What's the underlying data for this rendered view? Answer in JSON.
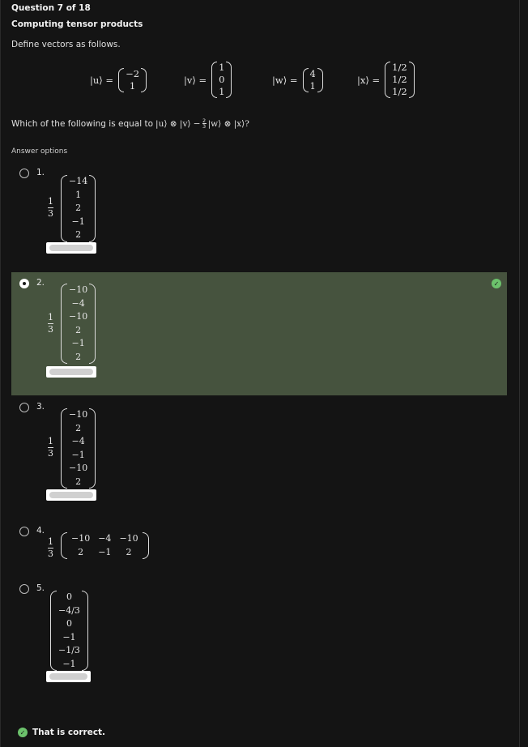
{
  "header": {
    "question_counter": "Question 7 of 18",
    "title": "Computing tensor products"
  },
  "prompt": {
    "intro": "Define vectors as follows.",
    "vectors": [
      {
        "name": "|u⟩ =",
        "entries": [
          "−2",
          "1"
        ]
      },
      {
        "name": "|v⟩ =",
        "entries": [
          "1",
          "0",
          "1"
        ]
      },
      {
        "name": "|w⟩ =",
        "entries": [
          "4",
          "1"
        ]
      },
      {
        "name": "|x⟩ =",
        "entries": [
          "1/2",
          "1/2",
          "1/2"
        ]
      }
    ],
    "question_prefix": "Which of the following is equal to ",
    "question_math_1": "|u⟩ ⊗ |v⟩ − ",
    "question_frac_num": "2",
    "question_frac_den": "3",
    "question_math_2": "|w⟩ ⊗ |x⟩?",
    "answer_options_label": "Answer options"
  },
  "options": [
    {
      "number": "1.",
      "coef_num": "1",
      "coef_den": "3",
      "entries": [
        "−14",
        "1",
        "2",
        "−1",
        "2"
      ],
      "selected": false
    },
    {
      "number": "2.",
      "coef_num": "1",
      "coef_den": "3",
      "entries": [
        "−10",
        "−4",
        "−10",
        "2",
        "−1",
        "2"
      ],
      "selected": true
    },
    {
      "number": "3.",
      "coef_num": "1",
      "coef_den": "3",
      "entries": [
        "−10",
        "2",
        "−4",
        "−1",
        "−10",
        "2"
      ],
      "selected": false
    },
    {
      "number": "4.",
      "coef_num": "1",
      "coef_den": "3",
      "matrix_cols": [
        [
          "−10",
          "2"
        ],
        [
          "−4",
          "−1"
        ],
        [
          "−10",
          "2"
        ]
      ],
      "selected": false
    },
    {
      "number": "5.",
      "entries": [
        "0",
        "−4/3",
        "0",
        "−1",
        "−1/3",
        "−1"
      ],
      "selected": false
    }
  ],
  "feedback": {
    "icon": "check-circle-icon",
    "text": "That is correct.",
    "color": "#6cc26c"
  },
  "colors": {
    "background": "#141414",
    "selected_background": "#46533e",
    "correct": "#6cc26c"
  }
}
